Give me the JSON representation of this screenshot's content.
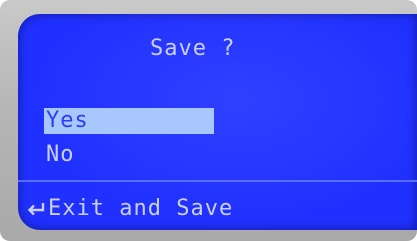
{
  "dialog": {
    "title": "Save ?",
    "options": [
      {
        "label": "Yes",
        "selected": true
      },
      {
        "label": "No",
        "selected": false
      }
    ]
  },
  "footer": {
    "icon": "enter-return-icon",
    "label": "Exit and Save"
  },
  "colors": {
    "screen_background": "#1f30ff",
    "text": "#c9d0ff",
    "highlight": "#a9c7ff",
    "bezel": "#b6b6b6"
  }
}
